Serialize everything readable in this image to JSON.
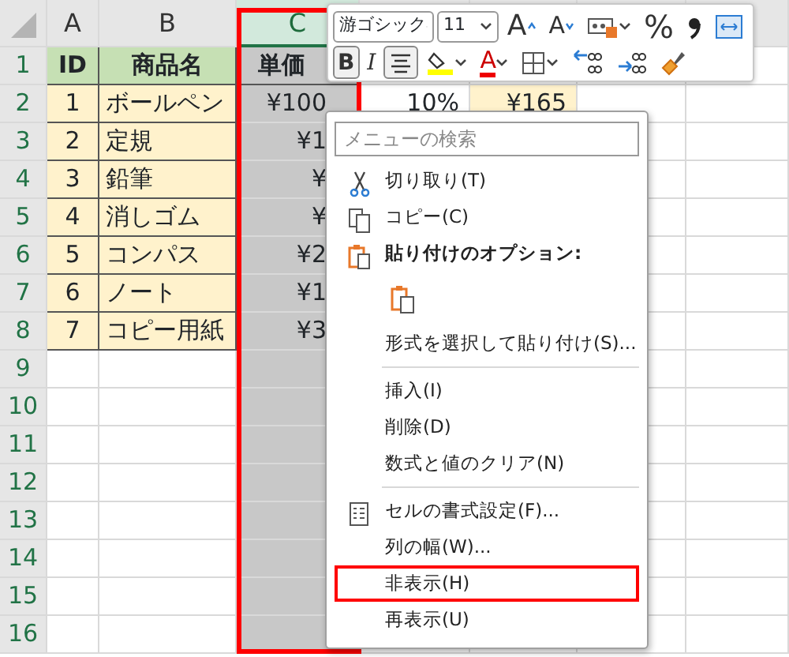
{
  "columns": [
    {
      "label": "A",
      "selected": false
    },
    {
      "label": "B",
      "selected": false
    },
    {
      "label": "C",
      "selected": true
    }
  ],
  "rows": [
    {
      "number": "1",
      "cells": [
        {
          "text": "ID",
          "kind": "header"
        },
        {
          "text": "商品名",
          "kind": "header"
        },
        {
          "text": "単価",
          "kind": "header"
        }
      ]
    },
    {
      "number": "2",
      "cells": [
        {
          "text": "1",
          "kind": "id"
        },
        {
          "text": "ボールペン",
          "kind": "name"
        },
        {
          "text": "¥100",
          "kind": "number"
        },
        {
          "text": "10%",
          "kind": "number"
        },
        {
          "text": "¥165",
          "kind": "result"
        }
      ]
    },
    {
      "number": "3",
      "cells": [
        {
          "text": "2",
          "kind": "id"
        },
        {
          "text": "定規",
          "kind": "name"
        },
        {
          "text": "¥1",
          "kind": "number"
        }
      ]
    },
    {
      "number": "4",
      "cells": [
        {
          "text": "3",
          "kind": "id"
        },
        {
          "text": "鉛筆",
          "kind": "name"
        },
        {
          "text": "¥",
          "kind": "number"
        }
      ]
    },
    {
      "number": "5",
      "cells": [
        {
          "text": "4",
          "kind": "id"
        },
        {
          "text": "消しゴム",
          "kind": "name"
        },
        {
          "text": "¥",
          "kind": "number"
        }
      ]
    },
    {
      "number": "6",
      "cells": [
        {
          "text": "5",
          "kind": "id"
        },
        {
          "text": "コンパス",
          "kind": "name"
        },
        {
          "text": "¥2",
          "kind": "number"
        }
      ]
    },
    {
      "number": "7",
      "cells": [
        {
          "text": "6",
          "kind": "id"
        },
        {
          "text": "ノート",
          "kind": "name"
        },
        {
          "text": "¥1",
          "kind": "number"
        }
      ]
    },
    {
      "number": "8",
      "cells": [
        {
          "text": "7",
          "kind": "id"
        },
        {
          "text": "コピー用紙",
          "kind": "name"
        },
        {
          "text": "¥3",
          "kind": "number"
        }
      ]
    },
    {
      "number": "9",
      "cells": []
    },
    {
      "number": "10",
      "cells": []
    },
    {
      "number": "11",
      "cells": []
    },
    {
      "number": "12",
      "cells": []
    },
    {
      "number": "13",
      "cells": []
    },
    {
      "number": "14",
      "cells": []
    },
    {
      "number": "15",
      "cells": []
    },
    {
      "number": "16",
      "cells": []
    }
  ],
  "mini_toolbar": {
    "font": "游ゴシック",
    "size": "11",
    "row_1": [
      {
        "kind": "grow",
        "label": "A"
      },
      {
        "kind": "shrink",
        "label": "A"
      },
      {
        "kind": "number-format"
      },
      {
        "kind": "percent",
        "label": "%"
      },
      {
        "kind": "comma"
      },
      {
        "kind": "wrap"
      }
    ],
    "row_2": [
      {
        "kind": "bold",
        "label": "B",
        "selected": true
      },
      {
        "kind": "italic",
        "label": "I",
        "selected": false
      },
      {
        "kind": "align",
        "selected": true
      },
      {
        "kind": "fill"
      },
      {
        "kind": "font-color",
        "label": "A"
      },
      {
        "kind": "borders"
      },
      {
        "kind": "increase-decimal"
      },
      {
        "kind": "decrease-decimal"
      },
      {
        "kind": "painter"
      }
    ]
  },
  "context_menu": {
    "search_placeholder": "メニューの検索",
    "items": [
      {
        "kind": "cut",
        "label": "切り取り(T)",
        "highlighted": false
      },
      {
        "kind": "copy",
        "label": "コピー(C)",
        "highlighted": false
      },
      {
        "kind": "paste-heading",
        "label": "貼り付けのオプション:"
      },
      {
        "kind": "paste-button"
      },
      {
        "kind": "plain",
        "label": "形式を選択して貼り付け(S)...",
        "highlighted": false
      },
      {
        "kind": "separator"
      },
      {
        "kind": "plain",
        "label": "挿入(I)",
        "highlighted": false
      },
      {
        "kind": "plain",
        "label": "削除(D)",
        "highlighted": false
      },
      {
        "kind": "plain",
        "label": "数式と値のクリア(N)",
        "highlighted": false
      },
      {
        "kind": "separator"
      },
      {
        "kind": "format",
        "label": "セルの書式設定(F)...",
        "highlighted": false
      },
      {
        "kind": "plain",
        "label": "列の幅(W)...",
        "highlighted": false
      },
      {
        "kind": "plain",
        "label": "非表示(H)",
        "highlighted": true
      },
      {
        "kind": "plain",
        "label": "再表示(U)",
        "highlighted": false
      }
    ]
  }
}
